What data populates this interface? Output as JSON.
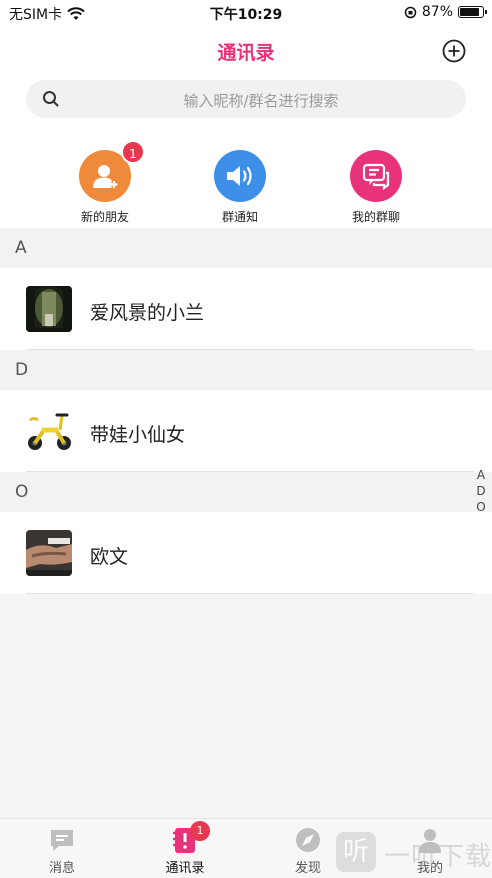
{
  "status": {
    "carrier": "无SIM卡",
    "time": "下午10:29",
    "battery": "87%",
    "battery_level": 0.87
  },
  "header": {
    "title": "通讯录"
  },
  "search": {
    "placeholder": "输入昵称/群名进行搜索"
  },
  "quick_actions": [
    {
      "label": "新的朋友",
      "badge": "1",
      "color": "#ef8a3b",
      "icon": "person-add-icon"
    },
    {
      "label": "群通知",
      "color": "#3d8fe8",
      "icon": "speaker-icon"
    },
    {
      "label": "我的群聊",
      "color": "#e8337a",
      "icon": "chat-bubbles-icon"
    }
  ],
  "sections": [
    {
      "letter": "A",
      "contacts": [
        {
          "name": "爱风景的小兰"
        }
      ]
    },
    {
      "letter": "D",
      "contacts": [
        {
          "name": "带娃小仙女"
        }
      ]
    },
    {
      "letter": "O",
      "contacts": [
        {
          "name": "欧文"
        }
      ]
    }
  ],
  "index_letters": [
    "A",
    "D",
    "O"
  ],
  "tabs": [
    {
      "label": "消息",
      "icon": "message-icon"
    },
    {
      "label": "通讯录",
      "icon": "contacts-icon",
      "badge": "1",
      "active": true
    },
    {
      "label": "发现",
      "icon": "discover-icon"
    },
    {
      "label": "我的",
      "icon": "profile-icon"
    }
  ],
  "watermark": {
    "text": "一听下载",
    "logo": "听"
  },
  "colors": {
    "accent": "#e8337a",
    "badge": "#e8384f"
  }
}
